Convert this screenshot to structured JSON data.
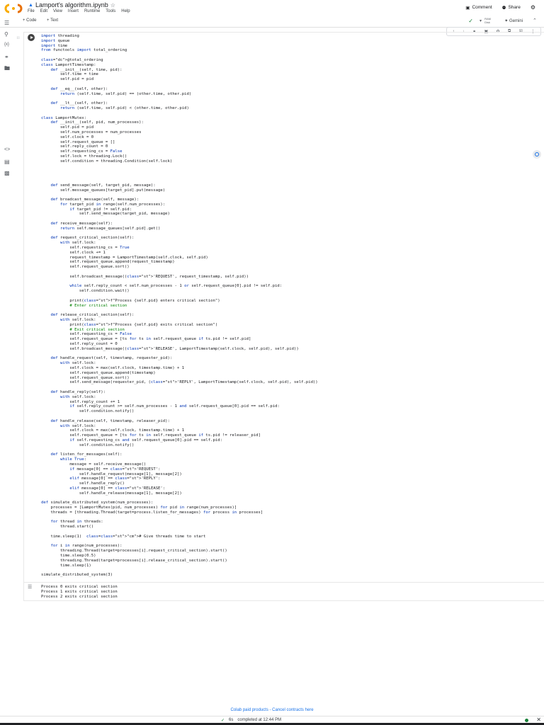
{
  "app": {
    "title": "Lamport's algorithm.ipynb",
    "menu": [
      "File",
      "Edit",
      "View",
      "Insert",
      "Runtime",
      "Tools",
      "Help"
    ],
    "comment_label": "Comment",
    "share_label": "Share"
  },
  "toolbar": {
    "code_label": "+ Code",
    "text_label": "+ Text",
    "ram_label": "RAM",
    "disk_label": "Disk",
    "gemini_label": "Gemini"
  },
  "cell": {
    "code_lines": [
      "import threading",
      "import queue",
      "import time",
      "from functools import total_ordering",
      "",
      "@total_ordering",
      "class LamportTimestamp:",
      "    def __init__(self, time, pid):",
      "        self.time = time",
      "        self.pid = pid",
      "",
      "    def __eq__(self, other):",
      "        return (self.time, self.pid) == (other.time, other.pid)",
      "",
      "    def __lt__(self, other):",
      "        return (self.time, self.pid) < (other.time, other.pid)",
      "",
      "class LamportMutex:",
      "    def __init__(self, pid, num_processes):",
      "        self.pid = pid",
      "        self.num_processes = num_processes",
      "        self.clock = 0",
      "        self.request_queue = []",
      "        self.reply_count = 0",
      "        self.requesting_cs = False",
      "        self.lock = threading.Lock()",
      "        self.condition = threading.Condition(self.lock)",
      "",
      "",
      "",
      "",
      "    def send_message(self, target_pid, message):",
      "        self.message_queues[target_pid].put(message)",
      "",
      "    def broadcast_message(self, message):",
      "        for target_pid in range(self.num_processes):",
      "            if target_pid != self.pid:",
      "                self.send_message(target_pid, message)",
      "",
      "    def receive_message(self):",
      "        return self.message_queues[self.pid].get()",
      "",
      "    def request_critical_section(self):",
      "        with self.lock:",
      "            self.requesting_cs = True",
      "            self.clock += 1",
      "            request_timestamp = LamportTimestamp(self.clock, self.pid)",
      "            self.request_queue.append(request_timestamp)",
      "            self.request_queue.sort()",
      "",
      "            self.broadcast_message(('REQUEST', request_timestamp, self.pid))",
      "",
      "            while self.reply_count < self.num_processes - 1 or self.request_queue[0].pid != self.pid:",
      "                self.condition.wait()",
      "",
      "            print(f\"Process {self.pid} enters critical section\")",
      "            # Enter critical section",
      "",
      "    def release_critical_section(self):",
      "        with self.lock:",
      "            print(f\"Process {self.pid} exits critical section\")",
      "            # Exit critical section",
      "            self.requesting_cs = False",
      "            self.request_queue = [ts for ts in self.request_queue if ts.pid != self.pid]",
      "            self.reply_count = 0",
      "            self.broadcast_message(('RELEASE', LamportTimestamp(self.clock, self.pid), self.pid))",
      "",
      "    def handle_request(self, timestamp, requester_pid):",
      "        with self.lock:",
      "            self.clock = max(self.clock, timestamp.time) + 1",
      "            self.request_queue.append(timestamp)",
      "            self.request_queue.sort()",
      "            self.send_message(requester_pid, ('REPLY', LamportTimestamp(self.clock, self.pid), self.pid))",
      "",
      "    def handle_reply(self):",
      "        with self.lock:",
      "            self.reply_count += 1",
      "            if self.reply_count >= self.num_processes - 1 and self.request_queue[0].pid == self.pid:",
      "                self.condition.notify()",
      "",
      "    def handle_release(self, timestamp, releaser_pid):",
      "        with self.lock:",
      "            self.clock = max(self.clock, timestamp.time) + 1",
      "            self.request_queue = [ts for ts in self.request_queue if ts.pid != releaser_pid]",
      "            if self.requesting_cs and self.request_queue[0].pid == self.pid:",
      "                self.condition.notify()",
      "",
      "    def listen_for_messages(self):",
      "        while True:",
      "            message = self.receive_message()",
      "            if message[0] == 'REQUEST':",
      "                self.handle_request(message[1], message[2])",
      "            elif message[0] == 'REPLY':",
      "                self.handle_reply()",
      "            elif message[0] == 'RELEASE':",
      "                self.handle_release(message[1], message[2])",
      "",
      "def simulate_distributed_system(num_processes):",
      "    processes = [LamportMutex(pid, num_processes) for pid in range(num_processes)]",
      "    threads = [threading.Thread(target=process.listen_for_messages) for process in processes]",
      "",
      "    for thread in threads:",
      "        thread.start()",
      "",
      "    time.sleep(1)  # Give threads time to start",
      "",
      "    for i in range(num_processes):",
      "        threading.Thread(target=processes[i].request_critical_section).start()",
      "        time.sleep(0.5)",
      "        threading.Thread(target=processes[i].release_critical_section).start()",
      "        time.sleep(1)",
      "",
      "simulate_distributed_system(3)"
    ],
    "output_lines": [
      "Process 0 exits critical section",
      "Process 1 exits critical section",
      "Process 2 exits critical section"
    ]
  },
  "footer": {
    "links_text": "Colab paid products - Cancel contracts here"
  },
  "statusbar": {
    "duration": "6s",
    "completed_text": "completed at 12:44 PM"
  }
}
